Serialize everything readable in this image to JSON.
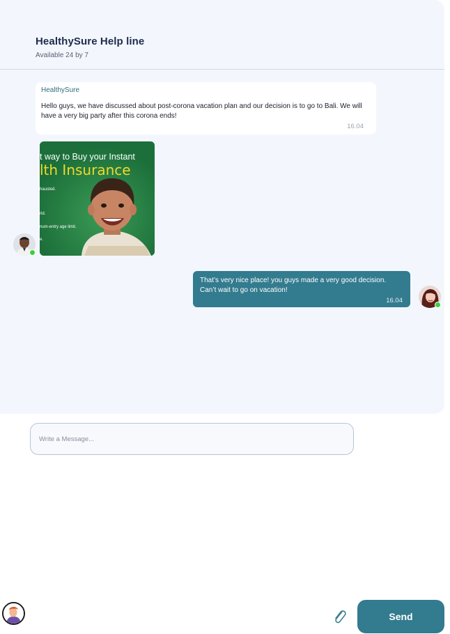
{
  "header": {
    "title": "HealthySure Help line",
    "subtitle": "Available 24 by 7"
  },
  "messages": [
    {
      "direction": "incoming",
      "sender": "HealthySure",
      "text": "Hello guys, we have discussed about post-corona vacation plan and our decision is to go to Bali. We will have a very big party after this corona ends!",
      "time": "16.04"
    },
    {
      "direction": "incoming",
      "type": "image",
      "image_text": {
        "line1": "t way to Buy your Instant",
        "line2": "lth Insurance",
        "bullet1": "hausted.",
        "bullet2": "rid.",
        "bullet3": "num-entry age limit.",
        "bullet4": "e."
      }
    },
    {
      "direction": "outgoing",
      "text": "That’s very nice place! you guys made a very good decision. Can’t wait to go on vacation!",
      "time": "16.04"
    }
  ],
  "composer": {
    "placeholder": "Write a Message..."
  },
  "actions": {
    "send_label": "Send",
    "attach_icon": "paperclip-icon"
  },
  "colors": {
    "accent": "#337b8e",
    "panel": "#f3f7fd",
    "online": "#3ccf3c"
  }
}
